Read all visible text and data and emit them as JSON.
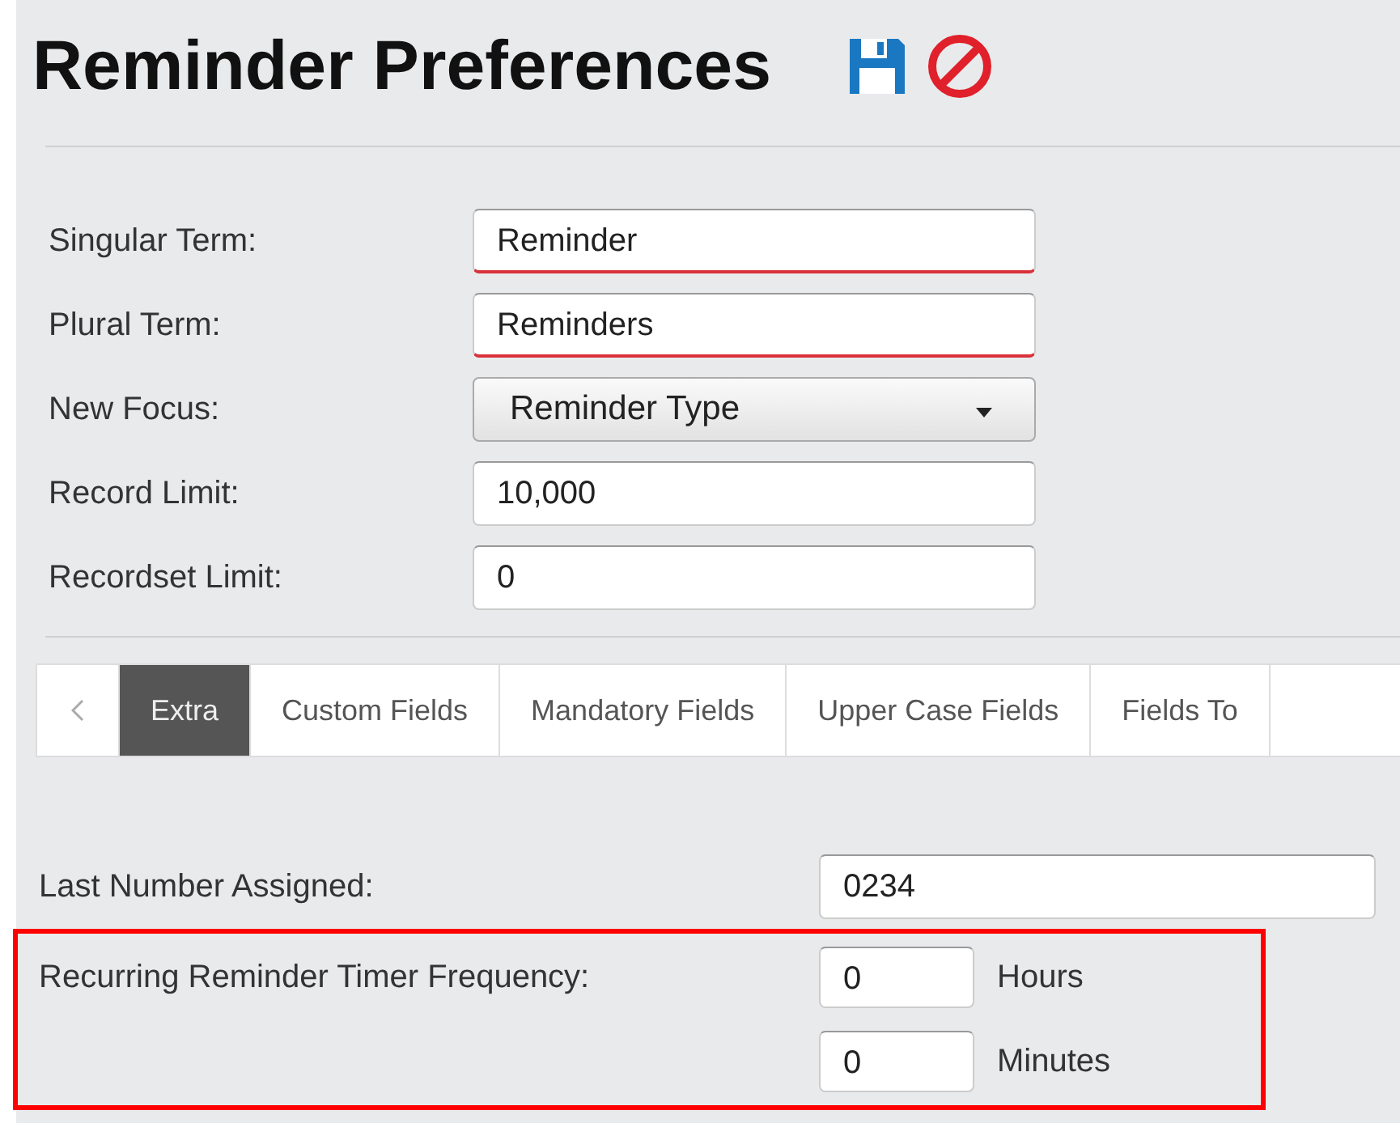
{
  "title": "Reminder Preferences",
  "fields": [
    {
      "label": "Singular Term:",
      "kind": "text",
      "value": "Reminder",
      "required": true
    },
    {
      "label": "Plural Term:",
      "kind": "text",
      "value": "Reminders",
      "required": true
    },
    {
      "label": "New Focus:",
      "kind": "select",
      "value": "Reminder Type"
    },
    {
      "label": "Record Limit:",
      "kind": "text",
      "value": "10,000",
      "required": false
    },
    {
      "label": "Recordset Limit:",
      "kind": "text",
      "value": "0",
      "required": false
    }
  ],
  "tabs": [
    {
      "label": "Extra",
      "selected": true
    },
    {
      "label": "Custom Fields",
      "selected": false
    },
    {
      "label": "Mandatory Fields",
      "selected": false
    },
    {
      "label": "Upper Case Fields",
      "selected": false
    },
    {
      "label": "Fields To",
      "selected": false
    }
  ],
  "last_number": {
    "label": "Last Number Assigned:",
    "value": "0234"
  },
  "timer_frequency": {
    "label": "Recurring Reminder Timer Frequency:",
    "highlighted": true,
    "units": [
      {
        "value": "0",
        "unit": "Hours"
      },
      {
        "value": "0",
        "unit": "Minutes"
      }
    ]
  }
}
